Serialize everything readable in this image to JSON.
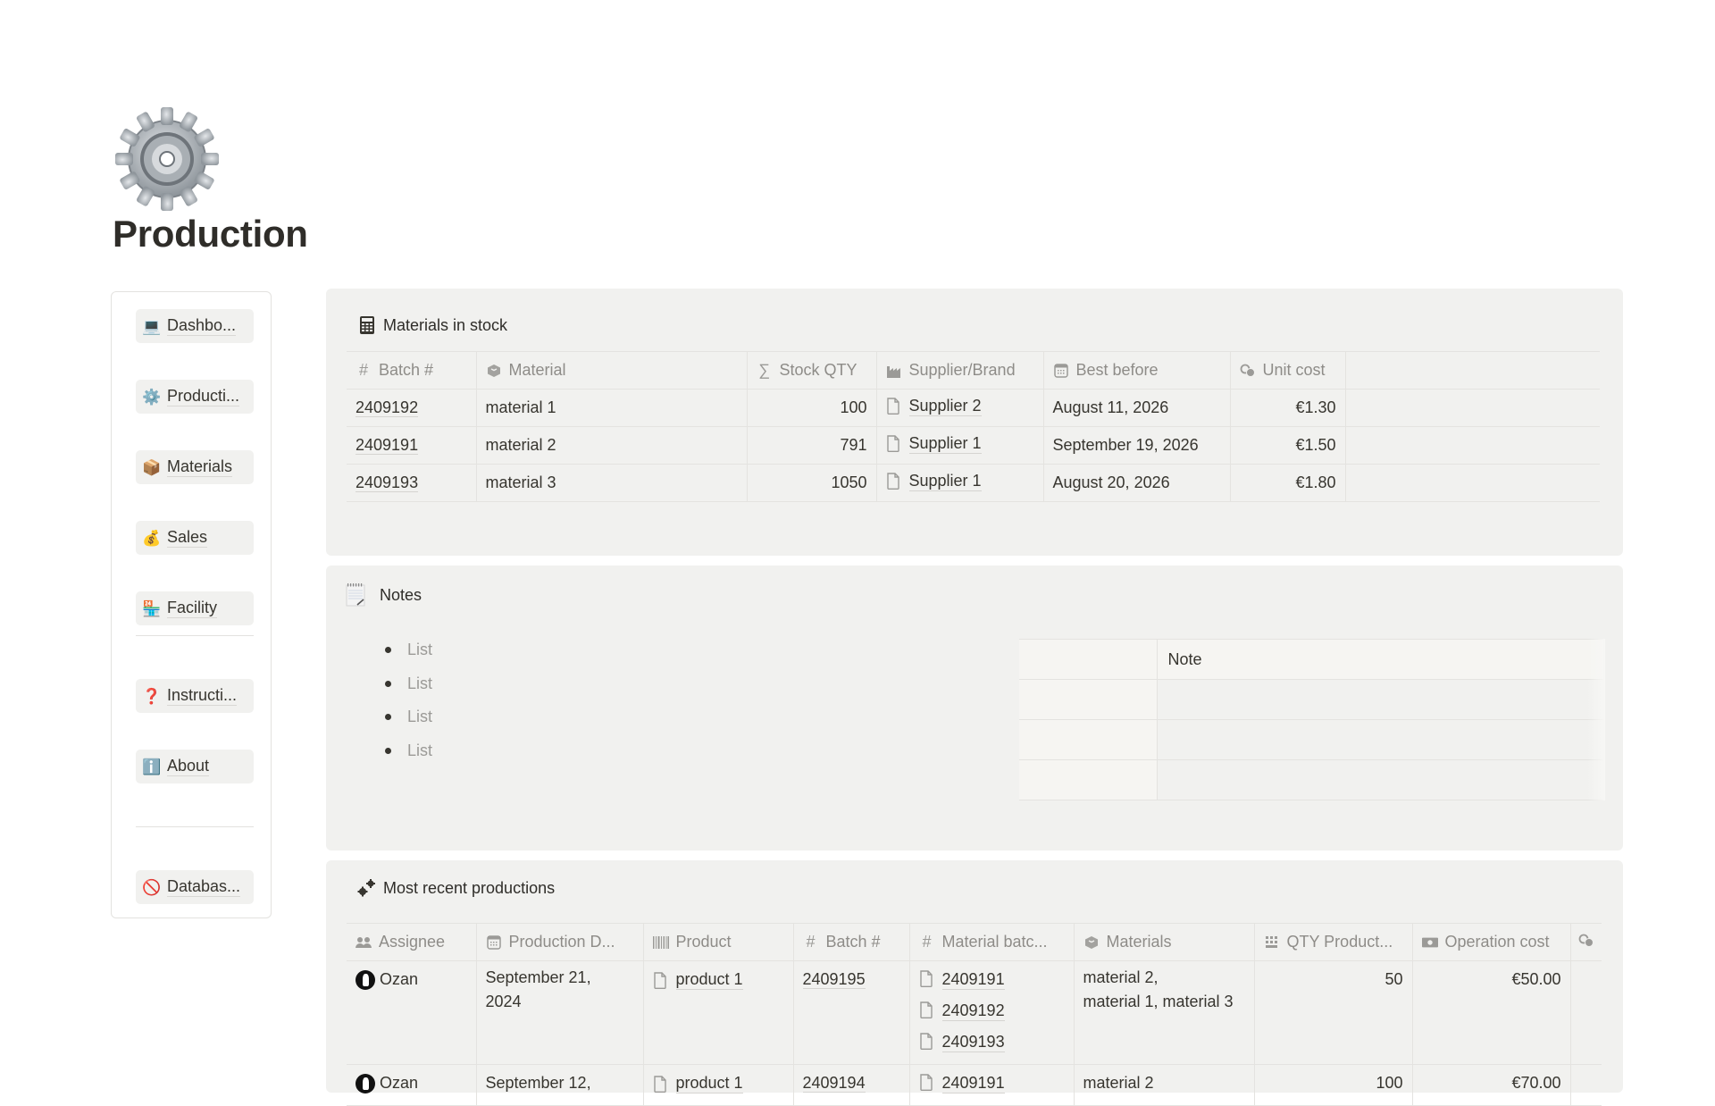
{
  "page": {
    "title": "Production",
    "icon": "gear-icon"
  },
  "sidebar": {
    "items": [
      {
        "label": "Dashbo...",
        "icon": "laptop-icon",
        "emoji": "💻"
      },
      {
        "label": "Producti...",
        "icon": "gear-icon",
        "emoji": "⚙️"
      },
      {
        "label": "Materials",
        "icon": "package-icon",
        "emoji": "📦"
      },
      {
        "label": "Sales",
        "icon": "money-bag-icon",
        "emoji": "💰"
      },
      {
        "label": "Facility",
        "icon": "convenience-store-icon",
        "emoji": "🏪"
      },
      {
        "label": "Instructi...",
        "icon": "question-mark-icon",
        "emoji": "❓"
      },
      {
        "label": "About",
        "icon": "information-icon",
        "emoji": "ℹ️"
      },
      {
        "label": "Databas...",
        "icon": "prohibited-icon",
        "emoji": "🚫"
      }
    ]
  },
  "materials": {
    "title": "Materials in stock",
    "columns": [
      "Batch #",
      "Material",
      "Stock QTY",
      "Supplier/Brand",
      "Best before",
      "Unit cost"
    ],
    "rows": [
      {
        "batch": "2409192",
        "material": "material 1",
        "qty": "100",
        "supplier": "Supplier 2",
        "best_before": "August 11, 2026",
        "unit_cost": "€1.30"
      },
      {
        "batch": "2409191",
        "material": "material 2",
        "qty": "791",
        "supplier": "Supplier 1",
        "best_before": "September 19, 2026",
        "unit_cost": "€1.50"
      },
      {
        "batch": "2409193",
        "material": "material 3",
        "qty": "1050",
        "supplier": "Supplier 1",
        "best_before": "August 20, 2026",
        "unit_cost": "€1.80"
      }
    ]
  },
  "notes": {
    "title": "Notes",
    "bullets": [
      "List",
      "List",
      "List",
      "List"
    ],
    "table_header": [
      "",
      "Note"
    ]
  },
  "productions": {
    "title": "Most recent productions",
    "columns": [
      "Assignee",
      "Production D...",
      "Product",
      "Batch #",
      "Material batc...",
      "Materials",
      "QTY Product...",
      "Operation cost",
      ""
    ],
    "rows": [
      {
        "assignee": "Ozan",
        "date_line1": "September 21,",
        "date_line2": "2024",
        "product": "product 1",
        "batch": "2409195",
        "material_batches": [
          "2409191",
          "2409192",
          "2409193"
        ],
        "materials_line1": "material 2,",
        "materials_line2": "material 1, material 3",
        "qty": "50",
        "operation_cost": "€50.00"
      },
      {
        "assignee": "Ozan",
        "date_line1": "September 12,",
        "date_line2": "",
        "product": "product 1",
        "batch": "2409194",
        "material_batches": [
          "2409191"
        ],
        "materials_line1": "material 2",
        "materials_line2": "",
        "qty": "100",
        "operation_cost": "€70.00"
      }
    ]
  }
}
